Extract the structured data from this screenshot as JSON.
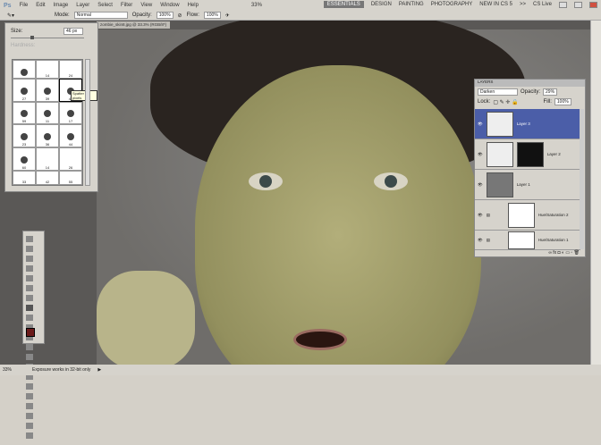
{
  "menu": {
    "logo": "Ps",
    "items": [
      "File",
      "Edit",
      "Image",
      "Layer",
      "Select",
      "Filter",
      "View",
      "Window",
      "Help"
    ],
    "zoom": "33%"
  },
  "workspaces": [
    "ESSENTIALS",
    "DESIGN",
    "PAINTING",
    "PHOTOGRAPHY",
    "NEW IN CS 5",
    ">>"
  ],
  "cslive": "CS Live",
  "options": {
    "mode_label": "Mode:",
    "mode": "Normal",
    "opacity_label": "Opacity:",
    "opacity": "100%",
    "flow_label": "Flow:",
    "flow": "100%"
  },
  "document": {
    "tab": "zombie_skin8.jpg @ 33.3% (RGB/8*)"
  },
  "brush": {
    "size_label": "Size:",
    "size": "46 px",
    "hardness_label": "Hardness:",
    "sizes": [
      "",
      "14",
      "24",
      "27",
      "39",
      "46",
      "59",
      "11",
      "17",
      "23",
      "36",
      "44",
      "60",
      "14",
      "26",
      "33",
      "42",
      "55"
    ],
    "tooltip": "Spatter 46 pixels"
  },
  "layers": {
    "title": "LAYERS",
    "blend": "Darken",
    "opacity_label": "Opacity:",
    "opacity": "29%",
    "lock_label": "Lock:",
    "fill_label": "Fill:",
    "fill": "100%",
    "items": [
      {
        "name": "Layer 3"
      },
      {
        "name": "Layer 2"
      },
      {
        "name": "Layer 1"
      },
      {
        "name": "Hue/Saturation 2"
      },
      {
        "name": "Hue/Saturation 1"
      }
    ]
  },
  "status": {
    "zoom": "33%",
    "info": "Exposure works in 32-bit only"
  }
}
